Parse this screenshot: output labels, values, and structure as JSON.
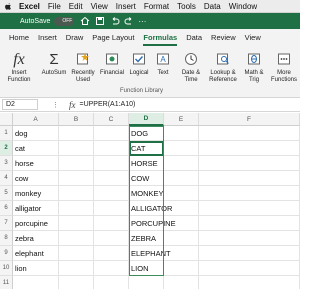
{
  "menubar": {
    "items": [
      "Excel",
      "File",
      "Edit",
      "View",
      "Insert",
      "Format",
      "Tools",
      "Data",
      "Window"
    ]
  },
  "titlebar": {
    "autosave_label": "AutoSave",
    "toggle_label": "OFF"
  },
  "ribbon_tabs": [
    "Home",
    "Insert",
    "Draw",
    "Page Layout",
    "Formulas",
    "Data",
    "Review",
    "View"
  ],
  "ribbon": {
    "insert_function": "Insert\nFunction",
    "autosum": "AutoSum",
    "recently_used": "Recently\nUsed",
    "financial": "Financial",
    "logical": "Logical",
    "text": "Text",
    "date_time": "Date &\nTime",
    "lookup": "Lookup &\nReference",
    "math": "Math &\nTrig",
    "more": "More\nFunctions",
    "group_label": "Function Library"
  },
  "formula_bar": {
    "name_box": "D2",
    "fx": "fx",
    "formula": "=UPPER(A1:A10)"
  },
  "columns": [
    "A",
    "B",
    "C",
    "D",
    "E",
    "F"
  ],
  "rows": [
    "1",
    "2",
    "3",
    "4",
    "5",
    "6",
    "7",
    "8",
    "9",
    "10",
    "11"
  ],
  "column_a": [
    "dog",
    "cat",
    "horse",
    "cow",
    "monkey",
    "alligator",
    "porcupine",
    "zebra",
    "elephant",
    "lion",
    ""
  ],
  "column_d": [
    "DOG",
    "CAT",
    "HORSE",
    "COW",
    "MONKEY",
    "ALLIGATOR",
    "PORCUPINE",
    "ZEBRA",
    "ELEPHANT",
    "LION",
    ""
  ],
  "colors": {
    "accent": "#1f7145",
    "selection_bg": "#dfeee5"
  }
}
